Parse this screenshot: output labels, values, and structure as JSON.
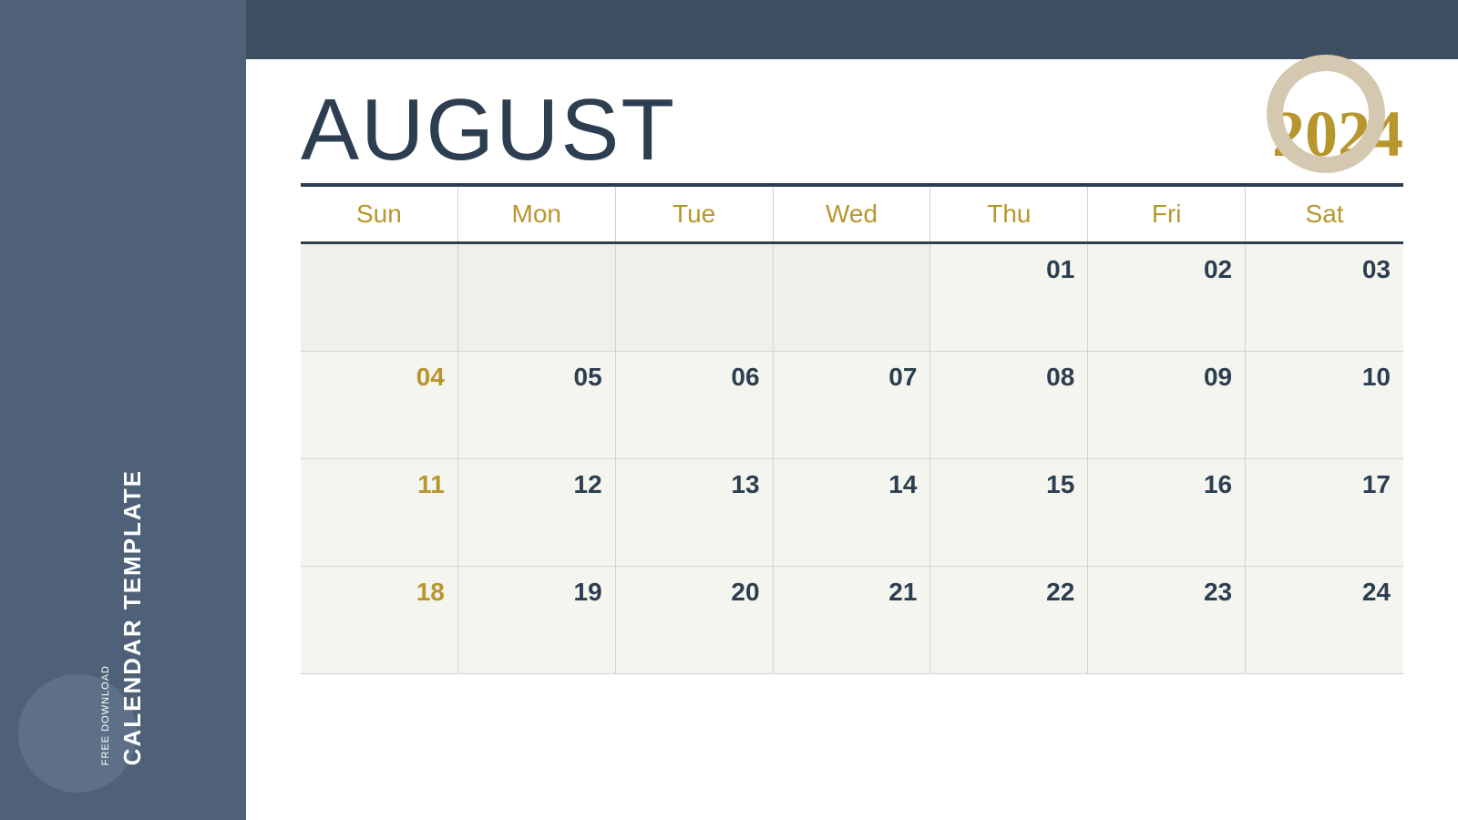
{
  "sidebar": {
    "free_download_label": "FREE DOWNLOAD",
    "calendar_template_label": "CALENDAR TEMPLATE"
  },
  "header": {
    "month": "AUGUST",
    "year": "2024"
  },
  "days_of_week": [
    "Sun",
    "Mon",
    "Tue",
    "Wed",
    "Thu",
    "Fri",
    "Sat"
  ],
  "weeks": [
    [
      {
        "date": "",
        "empty": true
      },
      {
        "date": "",
        "empty": true
      },
      {
        "date": "",
        "empty": true
      },
      {
        "date": "",
        "empty": true
      },
      {
        "date": "01",
        "empty": false,
        "sunday": false
      },
      {
        "date": "02",
        "empty": false,
        "sunday": false
      },
      {
        "date": "03",
        "empty": false,
        "sunday": false
      }
    ],
    [
      {
        "date": "04",
        "empty": false,
        "sunday": true
      },
      {
        "date": "05",
        "empty": false,
        "sunday": false
      },
      {
        "date": "06",
        "empty": false,
        "sunday": false
      },
      {
        "date": "07",
        "empty": false,
        "sunday": false
      },
      {
        "date": "08",
        "empty": false,
        "sunday": false
      },
      {
        "date": "09",
        "empty": false,
        "sunday": false
      },
      {
        "date": "10",
        "empty": false,
        "sunday": false
      }
    ],
    [
      {
        "date": "11",
        "empty": false,
        "sunday": true
      },
      {
        "date": "12",
        "empty": false,
        "sunday": false
      },
      {
        "date": "13",
        "empty": false,
        "sunday": false
      },
      {
        "date": "14",
        "empty": false,
        "sunday": false
      },
      {
        "date": "15",
        "empty": false,
        "sunday": false
      },
      {
        "date": "16",
        "empty": false,
        "sunday": false
      },
      {
        "date": "17",
        "empty": false,
        "sunday": false
      }
    ],
    [
      {
        "date": "18",
        "empty": false,
        "sunday": true
      },
      {
        "date": "19",
        "empty": false,
        "sunday": false
      },
      {
        "date": "20",
        "empty": false,
        "sunday": false
      },
      {
        "date": "21",
        "empty": false,
        "sunday": false
      },
      {
        "date": "22",
        "empty": false,
        "sunday": false
      },
      {
        "date": "23",
        "empty": false,
        "sunday": false
      },
      {
        "date": "24",
        "empty": false,
        "sunday": false
      }
    ]
  ],
  "colors": {
    "background": "#4f6179",
    "calendar_bg": "#ffffff",
    "top_bar": "#3d4e60",
    "month_color": "#2c3e50",
    "year_color": "#b8962e",
    "day_header_color": "#b8962e",
    "cell_bg": "#f5f5f0",
    "date_color": "#2c3e50",
    "sunday_color": "#b8962e",
    "border_color": "#d0d5c8"
  }
}
